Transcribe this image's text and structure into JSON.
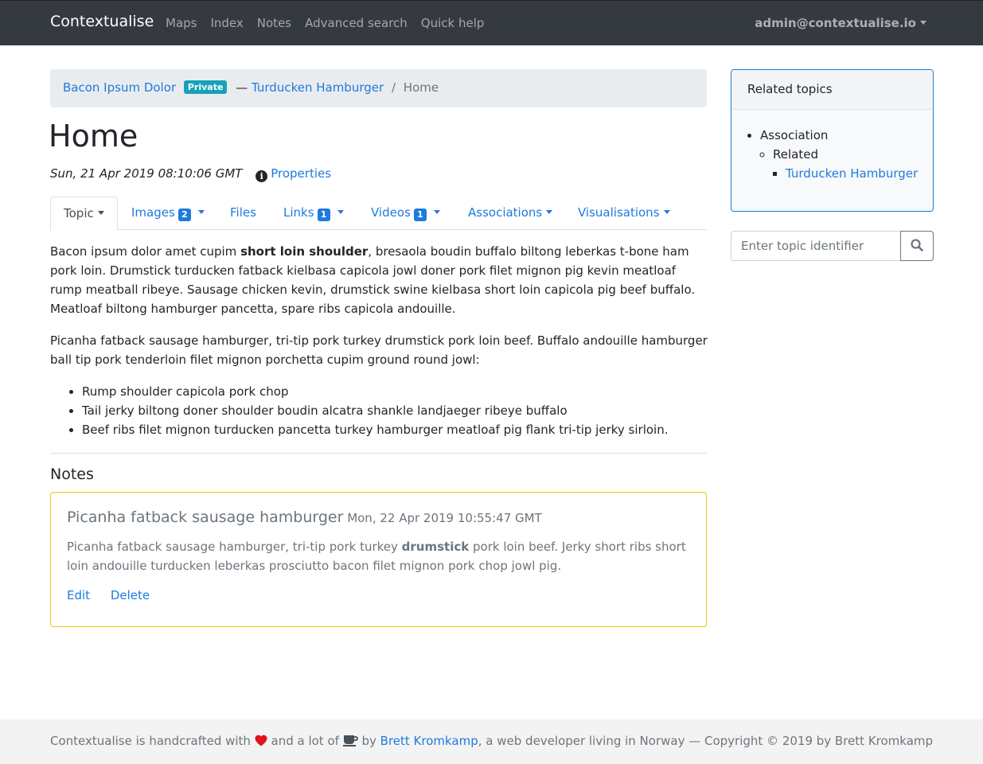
{
  "navbar": {
    "brand": "Contextualise",
    "links": [
      "Maps",
      "Index",
      "Notes",
      "Advanced search",
      "Quick help"
    ],
    "user": "admin@contextualise.io"
  },
  "breadcrumb": {
    "map": "Bacon Ipsum Dolor",
    "badge": "Private",
    "separator": "—",
    "parent": "Turducken Hamburger",
    "divider": "/",
    "current": "Home"
  },
  "topic": {
    "title": "Home",
    "timestamp": "Sun, 21 Apr 2019 08:10:06 GMT",
    "info_icon": "i",
    "properties_label": "Properties"
  },
  "tabs": [
    {
      "label": "Topic",
      "count": null
    },
    {
      "label": "Images",
      "count": "2"
    },
    {
      "label": "Files",
      "count": null
    },
    {
      "label": "Links",
      "count": "1"
    },
    {
      "label": "Videos",
      "count": "1"
    },
    {
      "label": "Associations",
      "count": null
    },
    {
      "label": "Visualisations",
      "count": null
    }
  ],
  "content": {
    "p1_before": "Bacon ipsum dolor amet cupim ",
    "p1_bold": "short loin shoulder",
    "p1_after": ", bresaola boudin buffalo biltong leberkas t-bone ham pork loin. Drumstick turducken fatback kielbasa capicola jowl doner pork filet mignon pig kevin meatloaf rump meatball ribeye. Sausage chicken kevin, drumstick swine kielbasa short loin capicola pig beef buffalo. Meatloaf biltong hamburger pancetta, spare ribs capicola andouille.",
    "p2": "Picanha fatback sausage hamburger, tri-tip pork turkey drumstick pork loin beef. Buffalo andouille hamburger ball tip pork tenderloin filet mignon porchetta cupim ground round jowl:",
    "bullets": [
      "Rump shoulder capicola pork chop",
      "Tail jerky biltong doner shoulder boudin alcatra shankle landjaeger ribeye buffalo",
      "Beef ribs filet mignon turducken pancetta turkey hamburger meatloaf pig flank tri-tip jerky sirloin."
    ]
  },
  "notes": {
    "heading": "Notes",
    "items": [
      {
        "title": "Picanha fatback sausage hamburger",
        "date": "Mon, 22 Apr 2019 10:55:47 GMT",
        "body_before": "Picanha fatback sausage hamburger, tri-tip pork turkey ",
        "body_bold": "drumstick",
        "body_after": " pork loin beef. Jerky short ribs short loin andouille turducken leberkas prosciutto bacon filet mignon pork chop jowl pig.",
        "edit_label": "Edit",
        "delete_label": "Delete"
      }
    ]
  },
  "related": {
    "header": "Related topics",
    "association": "Association",
    "role": "Related",
    "topic": "Turducken Hamburger"
  },
  "search": {
    "placeholder": "Enter topic identifier",
    "icon": "search-icon"
  },
  "footer": {
    "part1": "Contextualise is handcrafted with",
    "part2": "and a lot of",
    "part3": "by",
    "author_link": "Brett Kromkamp",
    "part4": ", a web developer living in Norway — Copyright © 2019 by Brett Kromkamp"
  },
  "colors": {
    "navbar_bg": "#343a40",
    "link": "#1f7ae0",
    "badge_private": "#17a2b8",
    "note_border": "#f0c419",
    "heart": "#e0141e"
  }
}
